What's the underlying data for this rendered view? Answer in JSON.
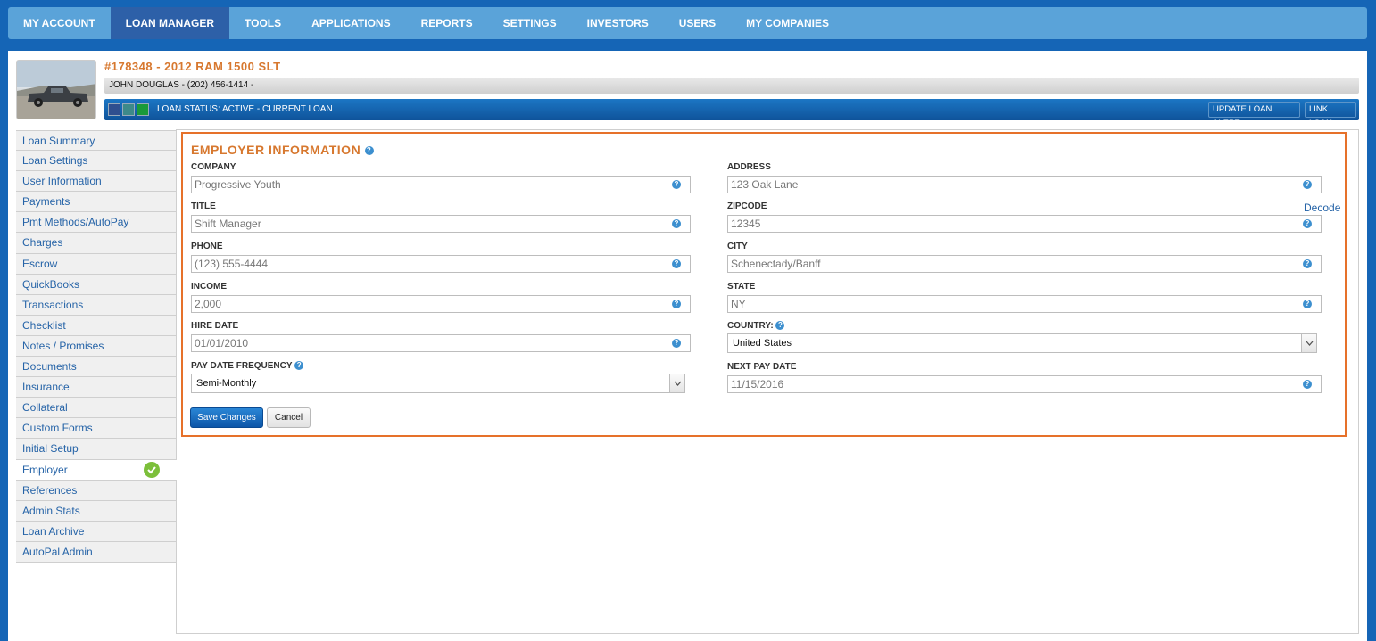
{
  "nav": {
    "items": [
      "MY ACCOUNT",
      "LOAN MANAGER",
      "TOOLS",
      "APPLICATIONS",
      "REPORTS",
      "SETTINGS",
      "INVESTORS",
      "USERS",
      "MY COMPANIES"
    ],
    "active": "LOAN MANAGER"
  },
  "header": {
    "loan_title": "#178348 - 2012 RAM 1500 SLT",
    "borrower": "JOHN DOUGLAS - (202) 456-1414 -",
    "status": "LOAN STATUS: ACTIVE - CURRENT LOAN",
    "update_alert_label": "UPDATE LOAN ALERT",
    "link_loan_label": "LINK LOAN",
    "status_colors": [
      "#2f4f8f",
      "#3d8a8a",
      "#1a9a3a"
    ]
  },
  "sidebar": {
    "items": [
      "Loan Summary",
      "Loan Settings",
      "User Information",
      "Payments",
      "Pmt Methods/AutoPay",
      "Charges",
      "Escrow",
      "QuickBooks",
      "Transactions",
      "Checklist",
      "Notes / Promises",
      "Documents",
      "Insurance",
      "Collateral",
      "Custom Forms",
      "Initial Setup",
      "Employer",
      "References",
      "Admin Stats",
      "Loan Archive",
      "AutoPal Admin"
    ],
    "active": "Employer"
  },
  "form": {
    "title": "EMPLOYER INFORMATION",
    "help_glyph": "?",
    "company": {
      "label": "COMPANY",
      "value": "Progressive Youth"
    },
    "title_field": {
      "label": "TITLE",
      "value": "Shift Manager"
    },
    "phone": {
      "label": "PHONE",
      "value": "(123) 555-4444"
    },
    "income": {
      "label": "INCOME",
      "value": "2,000"
    },
    "hire_date": {
      "label": "HIRE DATE",
      "value": "01/01/2010"
    },
    "pay_freq": {
      "label": "PAY DATE FREQUENCY",
      "value": "Semi-Monthly"
    },
    "address": {
      "label": "ADDRESS",
      "value": "123 Oak Lane"
    },
    "zipcode": {
      "label": "ZIPCODE",
      "value": "12345",
      "decode_label": "Decode"
    },
    "city": {
      "label": "CITY",
      "value": "Schenectady/Banff"
    },
    "state": {
      "label": "STATE",
      "value": "NY"
    },
    "country": {
      "label": "COUNTRY:",
      "value": "United States"
    },
    "next_pay": {
      "label": "NEXT PAY DATE",
      "value": "11/15/2016"
    },
    "save_label": "Save Changes",
    "cancel_label": "Cancel"
  }
}
